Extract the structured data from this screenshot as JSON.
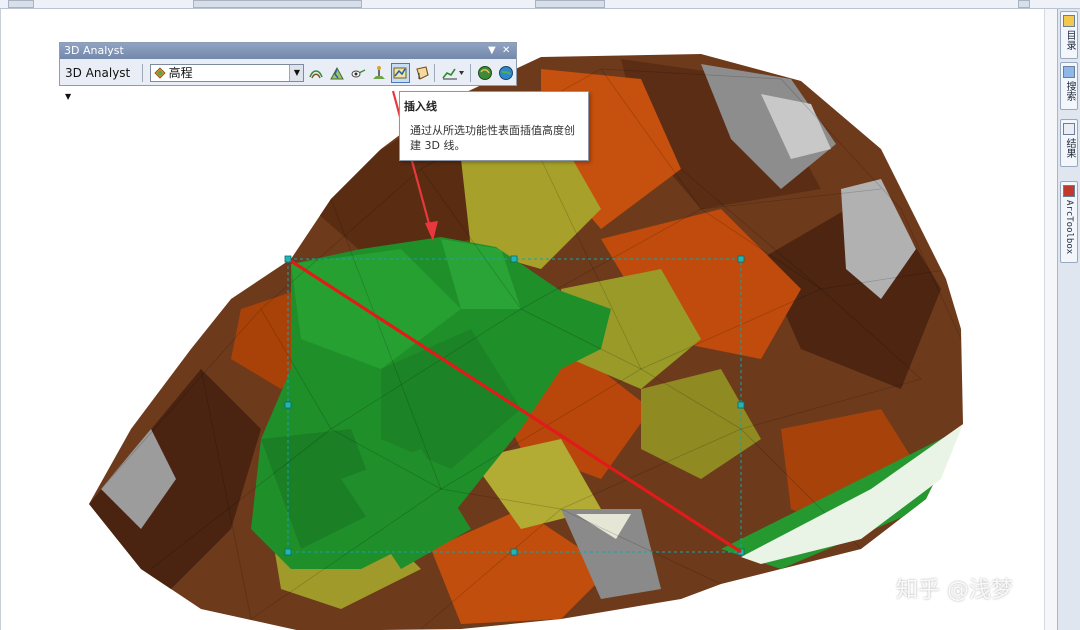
{
  "toolbar": {
    "title": "3D Analyst",
    "menu_label": "3D Analyst",
    "layer_value": "高程"
  },
  "tools": [
    {
      "name": "contour-tool-icon"
    },
    {
      "name": "steepest-path-icon"
    },
    {
      "name": "line-of-sight-icon"
    },
    {
      "name": "interpolate-point-icon"
    },
    {
      "name": "interpolate-line-icon",
      "active": true
    },
    {
      "name": "interpolate-polygon-icon"
    },
    {
      "name": "profile-graph-icon"
    },
    {
      "name": "arcscene-icon"
    },
    {
      "name": "arcglobe-icon"
    }
  ],
  "tooltip": {
    "title": "插入线",
    "body": "通过从所选功能性表面插值高度创建 3D 线。"
  },
  "right_dock": {
    "tabs": [
      {
        "label": "目录"
      },
      {
        "label": "搜索"
      },
      {
        "label": "结果"
      },
      {
        "label": "ArcToolbox"
      }
    ]
  },
  "watermark": "知乎 @浅梦",
  "colors": {
    "accent_red": "#e11a1a",
    "selection": "#1aa3a3",
    "titlebar": "#7f93b6"
  }
}
